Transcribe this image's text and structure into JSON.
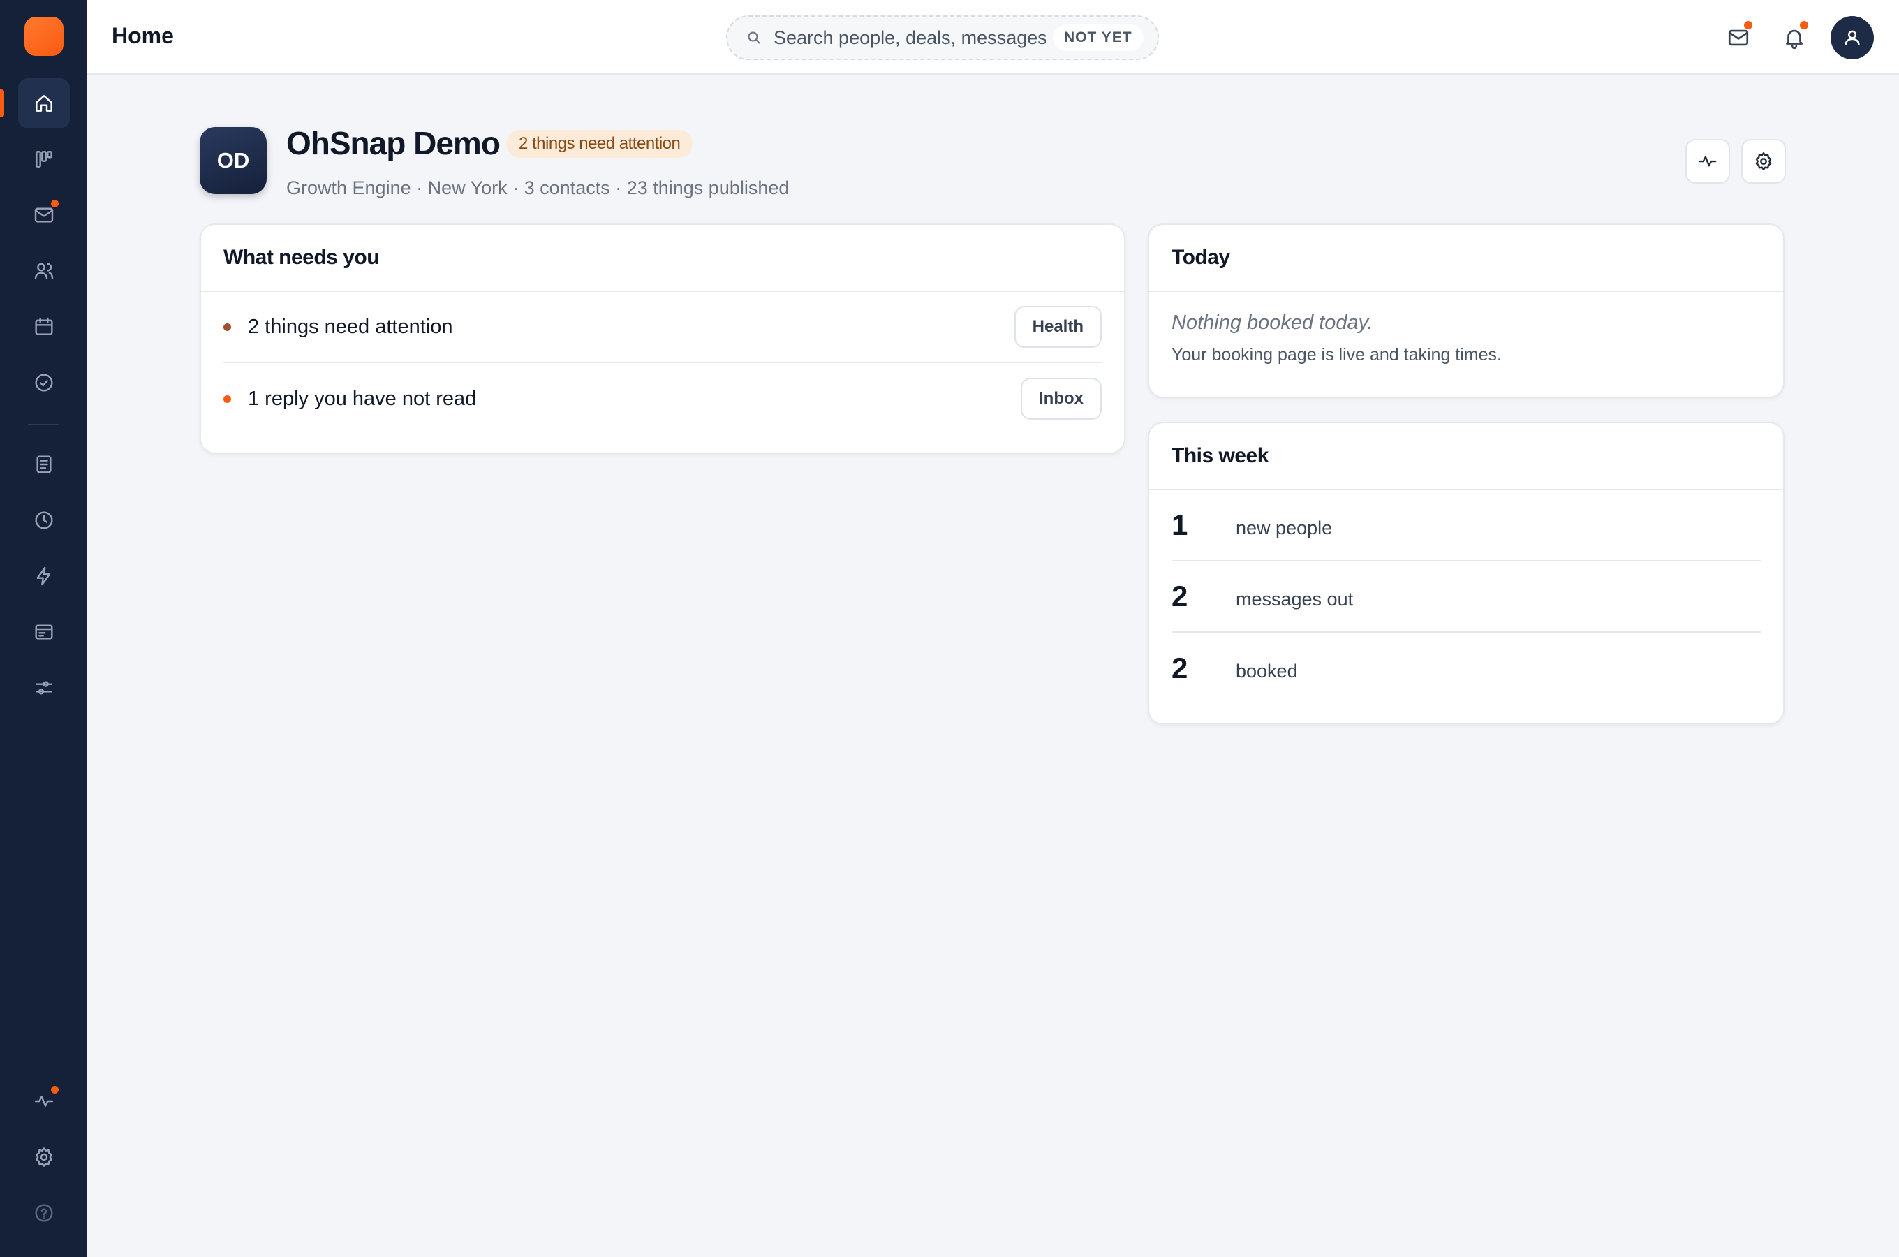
{
  "colors": {
    "accent": "#fa5a12",
    "sidebar_bg": "#152039",
    "bullet_brown": "#a0522d",
    "bullet_orange": "#fa5a12"
  },
  "sidebar": {
    "items": [
      {
        "icon": "home-icon",
        "active": true,
        "badge": false
      },
      {
        "icon": "kanban-icon",
        "badge": false
      },
      {
        "icon": "mail-icon",
        "badge": true
      },
      {
        "icon": "users-icon",
        "badge": false
      },
      {
        "icon": "calendar-icon",
        "badge": false
      },
      {
        "icon": "check-circle-icon",
        "badge": false
      },
      {
        "icon": "document-icon",
        "badge": false
      },
      {
        "icon": "clock-icon",
        "badge": false
      },
      {
        "icon": "lightning-icon",
        "badge": false
      },
      {
        "icon": "browser-icon",
        "badge": false
      },
      {
        "icon": "sliders-icon",
        "badge": false
      },
      {
        "icon": "activity-icon",
        "badge": true
      },
      {
        "icon": "gear-icon",
        "badge": false
      },
      {
        "icon": "help-icon",
        "badge": false
      }
    ]
  },
  "topbar": {
    "title": "Home",
    "search": {
      "placeholder": "Search people, deals, messages",
      "badge": "NOT YET"
    }
  },
  "org": {
    "initials": "OD",
    "name": "OhSnap Demo",
    "attention_pill": "2 things need attention",
    "meta": "Growth Engine · New York · 3 contacts · 23 things published"
  },
  "needs_you": {
    "title": "What needs you",
    "rows": [
      {
        "text": "2 things need attention",
        "button": "Health"
      },
      {
        "text": "1 reply you have not read",
        "button": "Inbox"
      }
    ]
  },
  "today": {
    "title": "Today",
    "empty": "Nothing booked today.",
    "sub": "Your booking page is live and taking times."
  },
  "this_week": {
    "title": "This week",
    "stats": [
      {
        "value": "1",
        "label": "new people"
      },
      {
        "value": "2",
        "label": "messages out"
      },
      {
        "value": "2",
        "label": "booked"
      }
    ]
  }
}
